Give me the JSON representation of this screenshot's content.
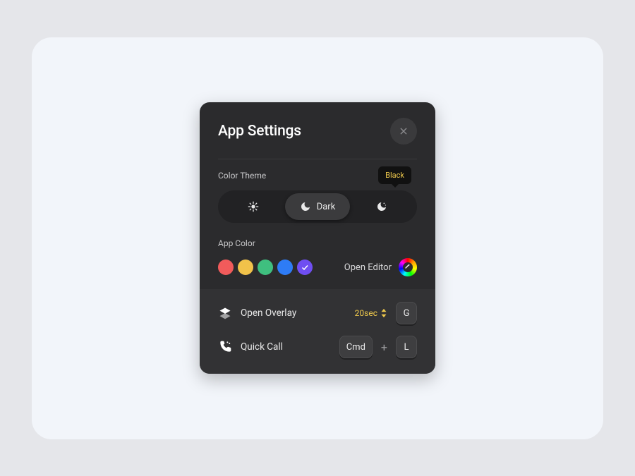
{
  "title": "App Settings",
  "sections": {
    "colorTheme": {
      "label": "Color Theme",
      "tooltip": "Black",
      "options": {
        "light": "Light",
        "dark": "Dark",
        "black": "Black"
      },
      "selected": "dark"
    },
    "appColor": {
      "label": "App Color",
      "swatches": [
        "#f15b5b",
        "#f1c24a",
        "#3fbf7f",
        "#2e7cf6",
        "#6f4ef2"
      ],
      "selectedIndex": 4,
      "openEditor": "Open Editor"
    }
  },
  "shortcuts": {
    "overlay": {
      "label": "Open Overlay",
      "timer": "20sec",
      "key": "G"
    },
    "quickCall": {
      "label": "Quick Call",
      "modifier": "Cmd",
      "combiner": "+",
      "key": "L"
    }
  }
}
